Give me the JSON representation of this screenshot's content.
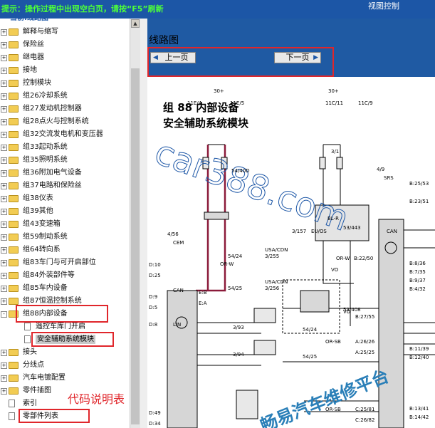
{
  "header": {
    "hint": "提示：操作过程中出现空白页，请按“F5”刷新",
    "right_label": "视图控制"
  },
  "tree": {
    "root": "当前:线路图",
    "items": [
      {
        "label": "解释与缩写",
        "exp": "+"
      },
      {
        "label": "保险丝",
        "exp": "+"
      },
      {
        "label": "继电器",
        "exp": "+"
      },
      {
        "label": "接地",
        "exp": "+"
      },
      {
        "label": "控制模块",
        "exp": "+"
      },
      {
        "label": "组26冷却系统",
        "exp": "+"
      },
      {
        "label": "组27发动机控制器",
        "exp": "+"
      },
      {
        "label": "组28点火与控制系统",
        "exp": "+"
      },
      {
        "label": "组32交流发电机和变压器",
        "exp": "+"
      },
      {
        "label": "组33起动系统",
        "exp": "+"
      },
      {
        "label": "组35照明系统",
        "exp": "+"
      },
      {
        "label": "组36附加电气设备",
        "exp": "+"
      },
      {
        "label": "组37电路和保险丝",
        "exp": "+"
      },
      {
        "label": "组38仪表",
        "exp": "+"
      },
      {
        "label": "组39其他",
        "exp": "+"
      },
      {
        "label": "组43变速箱",
        "exp": "+"
      },
      {
        "label": "组59制动系统",
        "exp": "+"
      },
      {
        "label": "组64转向系",
        "exp": "+"
      },
      {
        "label": "组83车门与可开启部位",
        "exp": "+"
      },
      {
        "label": "组84外装部件等",
        "exp": "+"
      },
      {
        "label": "组85车内设备",
        "exp": "+"
      },
      {
        "label": "组87恒温控制系统",
        "exp": "+"
      },
      {
        "label": "组88内部设备",
        "exp": "-"
      }
    ],
    "sub_items": [
      "遥控车库门开启",
      "安全辅助系统模块"
    ],
    "tail_items": [
      {
        "label": "接头",
        "exp": "+"
      },
      {
        "label": "分线点",
        "exp": "+"
      },
      {
        "label": "汽车电镀配置",
        "exp": "+"
      },
      {
        "label": "零件插图",
        "exp": "+"
      }
    ],
    "doc_items": [
      "索引",
      "零部件列表"
    ]
  },
  "main": {
    "title": "线路图",
    "prev_label": "上一页",
    "next_label": "下一页"
  },
  "diagram": {
    "heading1": "组 88 内部设备",
    "heading2": "安全辅助系统模块",
    "watermark": "car388.com",
    "watermark2": "畅易汽车维修平台",
    "labels": {
      "v30a": "30+",
      "v30b": "30+",
      "f1": "11E/4",
      "f2": "11E/5",
      "f3": "11C/11",
      "f4": "11C/9",
      "c54": "54/40D",
      "c31": "3/1",
      "srs": "SRS",
      "c49": "4/9",
      "c53": "53/443",
      "cem": "CEM",
      "c456": "4/56",
      "c3157": "3/157",
      "euos": "EU/OS",
      "c5424": "54/24",
      "c5425": "54/25",
      "usa1": "USA/CDN",
      "usa2": "USA/CDN",
      "c3255": "3/255",
      "c3256": "3/256",
      "c53408": "53/408",
      "c393": "3/93",
      "c394": "3/94",
      "c5424b": "54/24",
      "c5425b": "54/25",
      "r1": "B:25/53",
      "r2": "B:23/51",
      "r3": "B:8/36",
      "r4": "B:7/35",
      "r5": "B:9/37",
      "r6": "B:4/32",
      "r7": "B:11/39",
      "r8": "B:12/40",
      "r9": "B:13/41",
      "r10": "B:14/42",
      "r11": "B:22/50",
      "bl": "BL-R",
      "vo1": "VO",
      "vo2": "VO",
      "orw1": "OR-W",
      "orw2": "OR-W",
      "d10": "D:10",
      "d25": "D:25",
      "d9": "D:9",
      "d5": "D:5",
      "d8": "D:8",
      "d49": "D:49",
      "d34": "D:34",
      "eb": "E:B",
      "ea": "E:A",
      "can1": "CAN",
      "can2": "CAN",
      "lin": "LIN",
      "a2626": "A:26/26",
      "a2525": "A:25/25",
      "c2581": "C:25/81",
      "c2682": "C:26/82",
      "b2758": "B:27/55",
      "orsb1": "OR-SB",
      "orsb2": "OR-SB"
    }
  },
  "annotation": "代码说明表",
  "colors": {
    "header_blue": "#1c56a6",
    "hint_green": "#4dff3a",
    "highlight_red": "#e0262b",
    "folder_yellow": "#f2cc53",
    "wire_maroon": "#8b1a3a"
  }
}
